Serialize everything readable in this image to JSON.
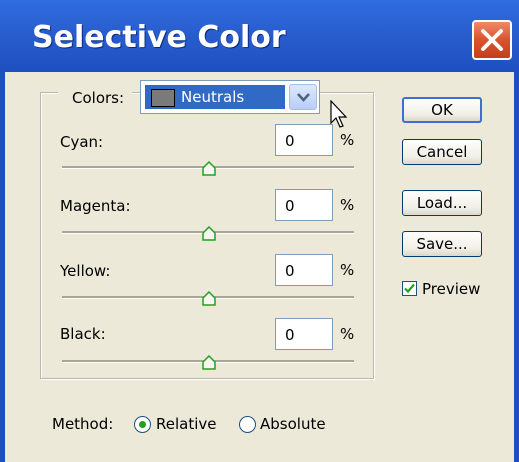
{
  "window": {
    "title": "Selective Color"
  },
  "colors": {
    "label": "Colors:",
    "selected": "Neutrals"
  },
  "rows": [
    {
      "label": "Cyan:",
      "value": "0",
      "unit": "%",
      "slider_fraction": 0.5
    },
    {
      "label": "Magenta:",
      "value": "0",
      "unit": "%",
      "slider_fraction": 0.5
    },
    {
      "label": "Yellow:",
      "value": "0",
      "unit": "%",
      "slider_fraction": 0.5
    },
    {
      "label": "Black:",
      "value": "0",
      "unit": "%",
      "slider_fraction": 0.5
    }
  ],
  "buttons": {
    "ok": "OK",
    "cancel": "Cancel",
    "load": "Load...",
    "save": "Save..."
  },
  "preview": {
    "label": "Preview",
    "checked": true
  },
  "method": {
    "label": "Method:",
    "options": [
      "Relative",
      "Absolute"
    ],
    "selected": "Relative"
  },
  "icons": {
    "close": "close-icon",
    "dropdown": "chevron-down-icon",
    "cursor": "mouse-pointer-icon",
    "thumb": "slider-thumb-icon"
  },
  "colors_palette": {
    "titlebar": "#2a5fd0",
    "close": "#d9532c",
    "dialog_bg": "#ece9d8",
    "selection": "#316ac5",
    "radio_dot": "#21a121"
  }
}
